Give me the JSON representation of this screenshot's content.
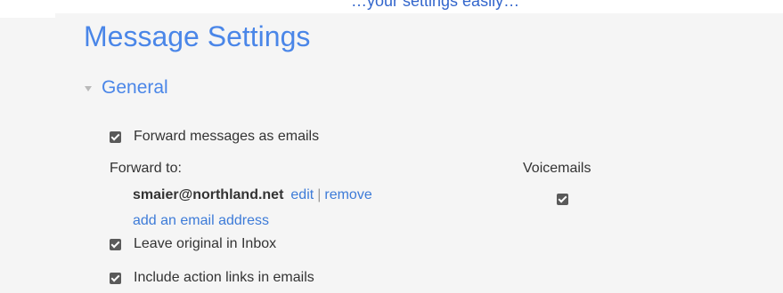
{
  "header_fragment": "…your settings easily…",
  "page_title": "Message Settings",
  "section": {
    "title": "General",
    "expanded": true,
    "caret_icon": "caret-down-icon"
  },
  "forward_messages": {
    "label": "Forward messages as emails",
    "checked": true
  },
  "forward_to": {
    "label": "Forward to:",
    "voicemails_label": "Voicemails",
    "email": "smaier@northland.net",
    "edit_label": "edit",
    "separator": "|",
    "remove_label": "remove",
    "add_label": "add an email address",
    "voicemails_checked": true
  },
  "leave_original": {
    "label": "Leave original in Inbox",
    "checked": true
  },
  "action_links": {
    "label": "Include action links in emails",
    "checked": true
  },
  "colors": {
    "title": "#4a86e8",
    "link": "#3d7bd8",
    "text": "#333333",
    "checkbox": "#5a5a5a",
    "background": "#f5f5f5"
  }
}
